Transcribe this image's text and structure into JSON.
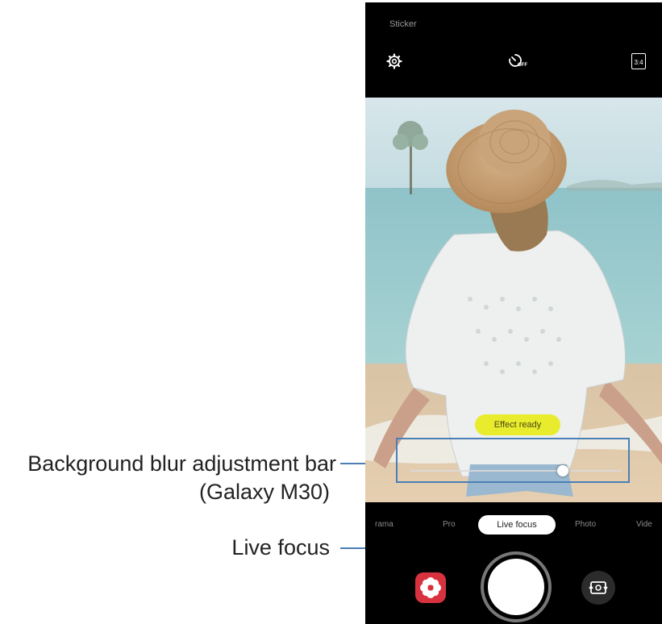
{
  "callouts": {
    "blur_bar_line1": "Background blur adjustment bar",
    "blur_bar_line2": "(Galaxy M30)",
    "live_focus": "Live focus"
  },
  "camera": {
    "mode_title": "Sticker",
    "timer_icon_label": "OFF",
    "ratio_label": "3:4",
    "effect_badge": "Effect ready",
    "blur_level": 0.72,
    "modes": [
      "rama",
      "Pro",
      "Live focus",
      "Photo",
      "Vide"
    ],
    "active_mode": "Live focus"
  },
  "colors": {
    "callout_line": "#4b7fb6",
    "effect_badge": "#e8ec2d",
    "sticker_button": "#d8323f"
  },
  "icons": [
    "gear-icon",
    "timer-off-icon",
    "aspect-ratio-icon",
    "flower-sticker-icon",
    "switch-camera-icon"
  ]
}
